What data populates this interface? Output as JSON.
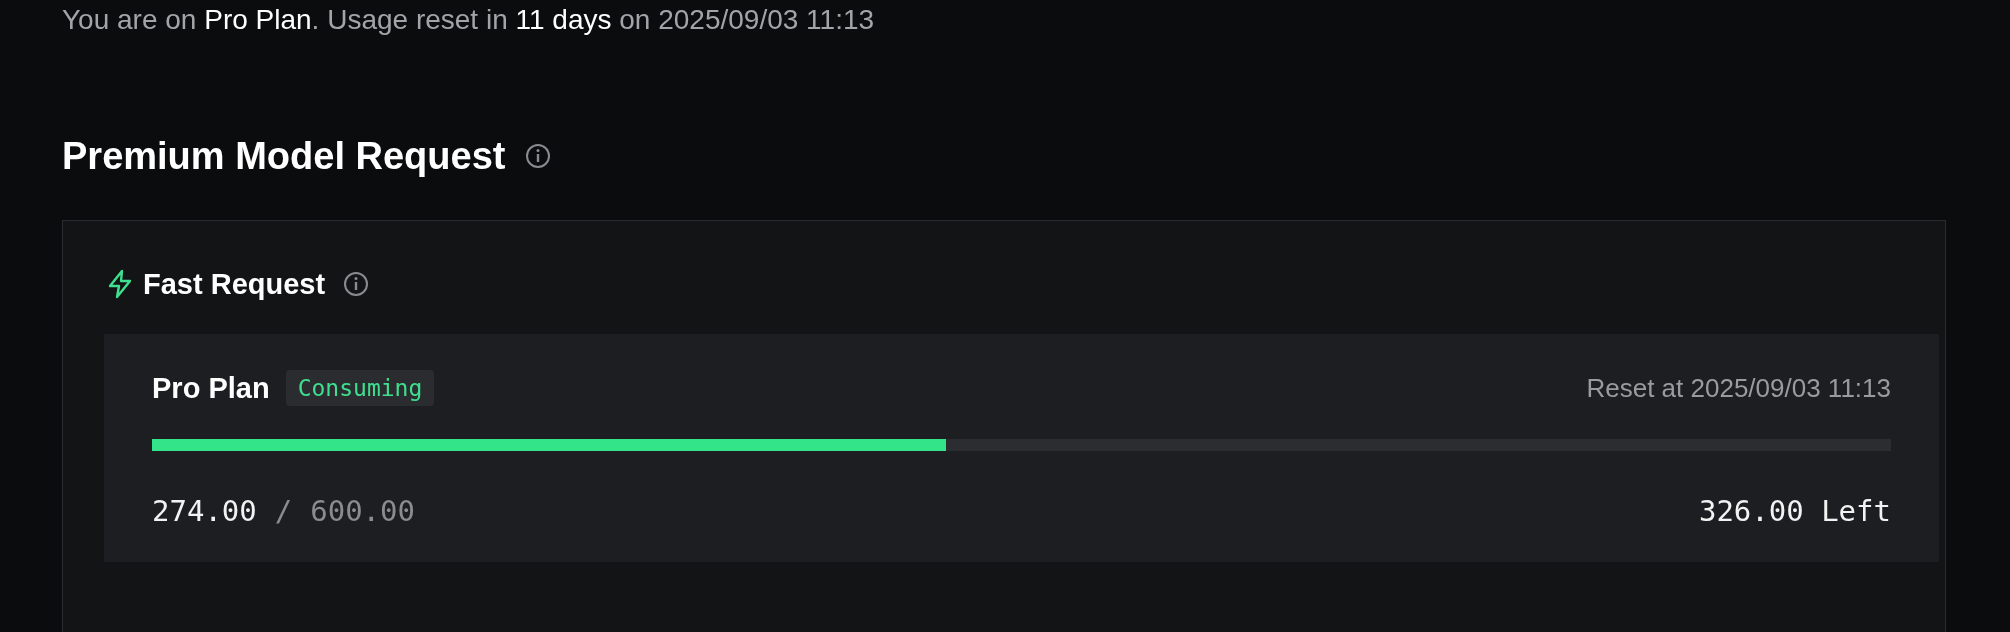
{
  "summary": "You are on **Pro Plan**. Usage reset in **11 days** on 2025/09/03 11:13",
  "section": {
    "title": "Premium Model Request"
  },
  "group": {
    "title": "Fast Request"
  },
  "plan": {
    "name": "Pro Plan",
    "status": "Consuming",
    "reset": "Reset at 2025/09/03 11:13",
    "level": 0.4567,
    "used": "274.00",
    "separator": "/",
    "total": "600.00",
    "remaining": "326.00 Left"
  }
}
